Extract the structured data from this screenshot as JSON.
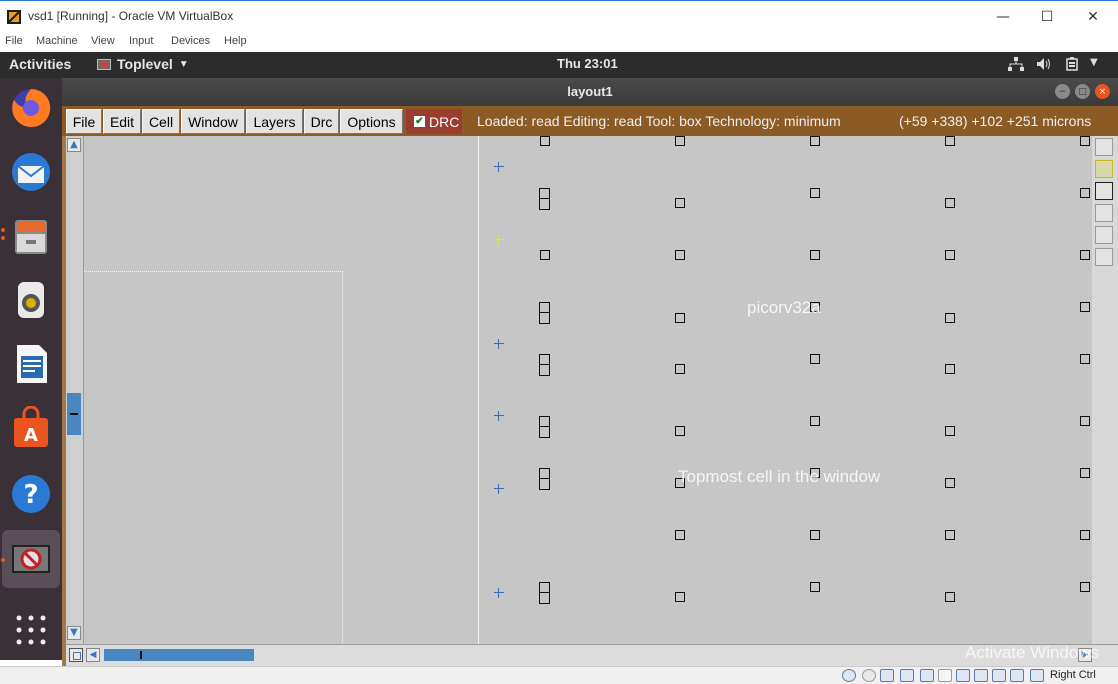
{
  "host": {
    "title": "vsd1 [Running] - Oracle VM VirtualBox",
    "minimize": "—",
    "maximize": "☐",
    "close": "✕",
    "menu": [
      "File",
      "Machine",
      "View",
      "Input",
      "Devices",
      "Help"
    ],
    "host_key_label": "Right Ctrl"
  },
  "topbar": {
    "activities": "Activities",
    "app_menu": "Toplevel",
    "clock": "Thu 23:01"
  },
  "dock": {
    "items": [
      "firefox",
      "thunderbird",
      "files",
      "rhythmbox",
      "libreoffice-writer",
      "software-center",
      "help",
      "virtualbox-app",
      "show-applications"
    ]
  },
  "magic": {
    "window_title": "layout1",
    "menu": [
      "File",
      "Edit",
      "Cell",
      "Window",
      "Layers",
      "Drc",
      "Options"
    ],
    "drc_label": "DRC",
    "drc_checked": true,
    "status": "Loaded: read Editing: read Tool: box  Technology: minimum",
    "coords": "(+59 +338) +102 +251 microns",
    "labels": {
      "cell_name": "picorv32a",
      "topmost_note": "Topmost cell in the window"
    },
    "colors": {
      "menubar": "#8b5a25",
      "drc_bg": "#9a3d2e",
      "canvas": "#c6c6c6",
      "cross_blue": "#3a6ab8",
      "cross_yellow": "#e6e040"
    }
  },
  "watermark": "Activate Windows"
}
